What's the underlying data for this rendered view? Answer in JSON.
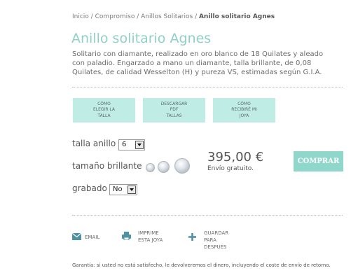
{
  "breadcrumb": {
    "items": [
      "Inicio",
      "Compromiso",
      "Anillos Solitarios"
    ],
    "separator": " / ",
    "current": "Anillo solitario Agnes"
  },
  "product": {
    "title": "Anillo solitario Agnes",
    "description": "Solitario con diamante, realizado en oro blanco de 18 Quilates y aleado con paladio. Engarzado a mano un diamante, talla brillante, de 0,08 Quilates, de calidad Wesselton (H) y pureza VS, estimadas según G.I.A."
  },
  "info_buttons": [
    {
      "lines": [
        "Cómo",
        "elegir la",
        "talla"
      ]
    },
    {
      "lines": [
        "Descargar",
        "pdf",
        "tallas"
      ]
    },
    {
      "lines": [
        "Cómo",
        "recibiré mi",
        "joya"
      ]
    }
  ],
  "options": {
    "talla_label": "talla anillo",
    "talla_value": "6",
    "brillante_label": "tamaño brillante",
    "grabado_label": "grabado",
    "grabado_value": "No"
  },
  "price": {
    "amount": "395,00 €",
    "shipping": "Envío gratuito."
  },
  "buy_button": {
    "label": "COMPRAR"
  },
  "actions": {
    "email": "Email",
    "print": [
      "Imprime",
      "esta joya"
    ],
    "save": [
      "Guardar",
      "para",
      "después"
    ]
  },
  "guarantee": "Garantía: si usted no está satisfecho, le devolveremos el dinero, incluyendo el coste de envío de retorno.",
  "colors": {
    "accent": "#8fd1c7",
    "info_button_bg": "#bfece4",
    "buy_button_bg": "#8fd6cb",
    "icon": "#4f93a3"
  }
}
